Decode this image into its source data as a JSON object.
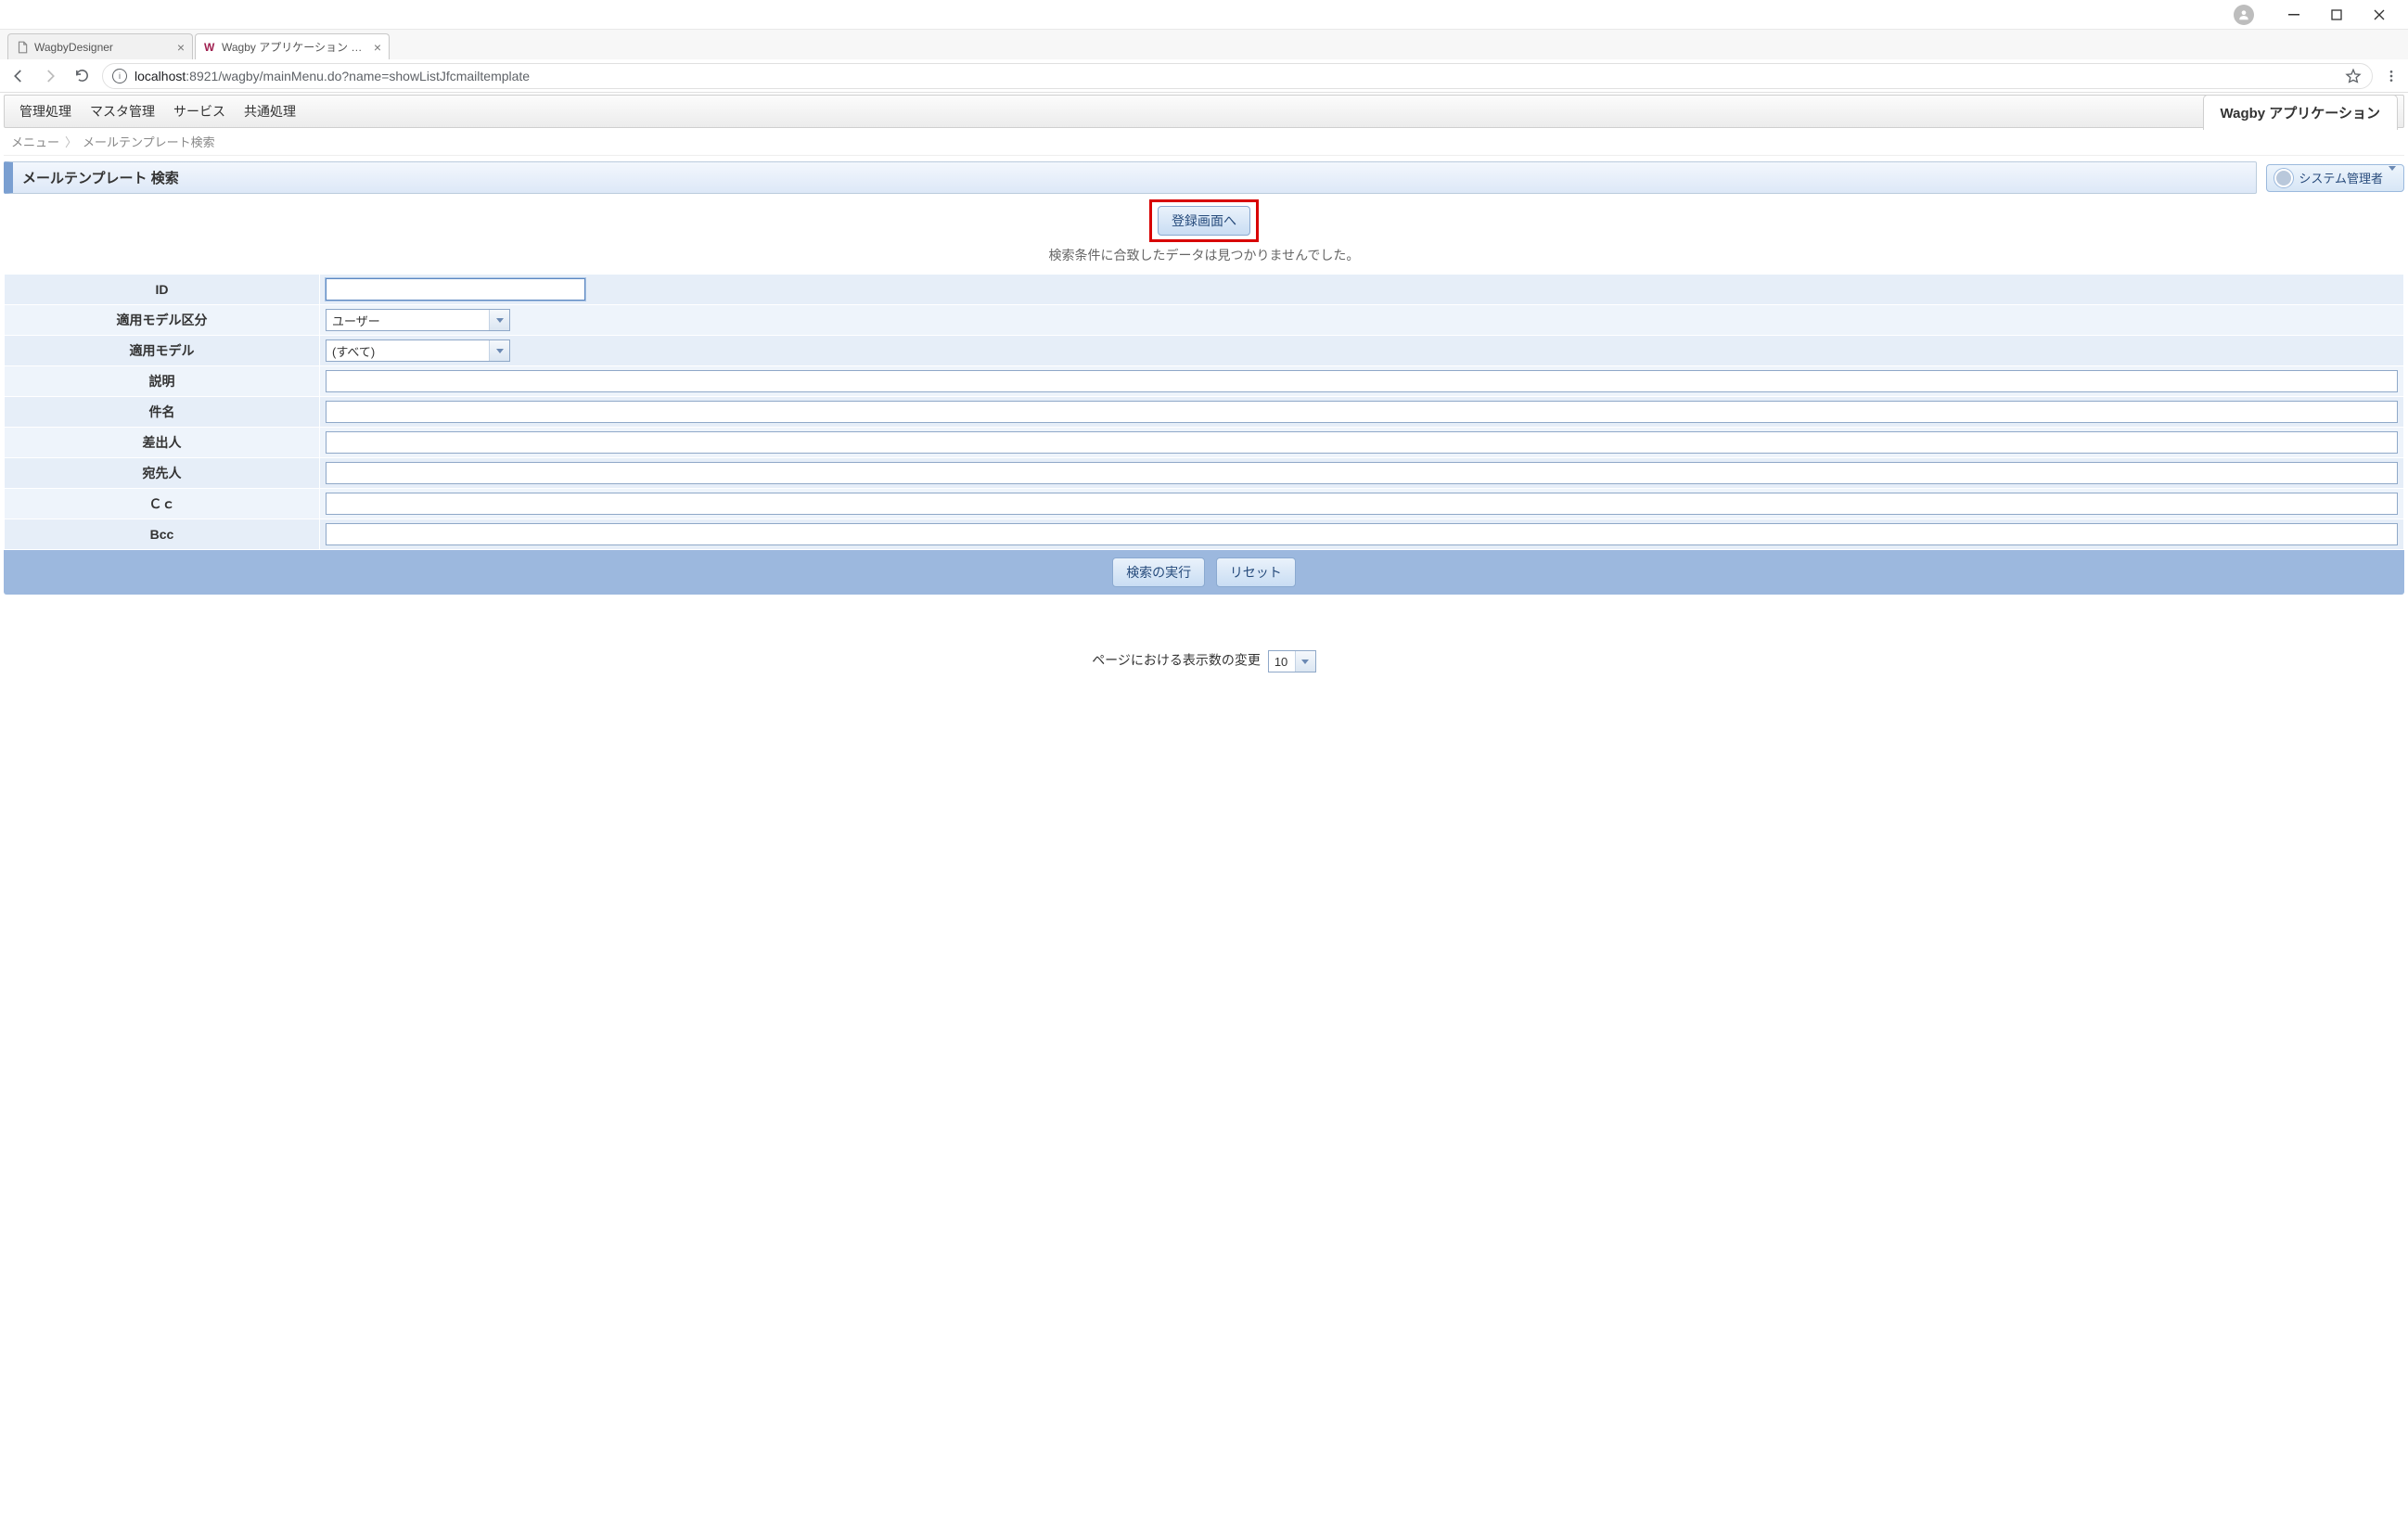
{
  "browser": {
    "tabs": [
      {
        "title": "WagbyDesigner",
        "active": false,
        "favicon": "doc"
      },
      {
        "title": "Wagby アプリケーション メー",
        "active": true,
        "favicon": "w"
      }
    ],
    "url_host": "localhost",
    "url_port": ":8921",
    "url_path": "/wagby/mainMenu.do?name=showListJfcmailtemplate"
  },
  "app": {
    "menus": [
      "管理処理",
      "マスタ管理",
      "サービス",
      "共通処理"
    ],
    "brand": "Wagby アプリケーション",
    "breadcrumbs": [
      "メニュー",
      "メールテンプレート検索"
    ],
    "page_title": "メールテンプレート 検索",
    "user_label": "システム管理者",
    "register_button": "登録画面へ",
    "nodata_message": "検索条件に合致したデータは見つかりませんでした。",
    "search_button": "検索の実行",
    "reset_button": "リセット",
    "pager_label": "ページにおける表示数の変更",
    "pager_value": "10"
  },
  "form": {
    "fields": {
      "id": {
        "label": "ID",
        "value": ""
      },
      "model_cat": {
        "label": "適用モデル区分",
        "value": "ユーザー"
      },
      "model": {
        "label": "適用モデル",
        "value": "(すべて)"
      },
      "desc": {
        "label": "説明",
        "value": ""
      },
      "subject": {
        "label": "件名",
        "value": ""
      },
      "from": {
        "label": "差出人",
        "value": ""
      },
      "to": {
        "label": "宛先人",
        "value": ""
      },
      "cc": {
        "label": "Ｃｃ",
        "value": ""
      },
      "bcc": {
        "label": "Bcc",
        "value": ""
      }
    }
  }
}
